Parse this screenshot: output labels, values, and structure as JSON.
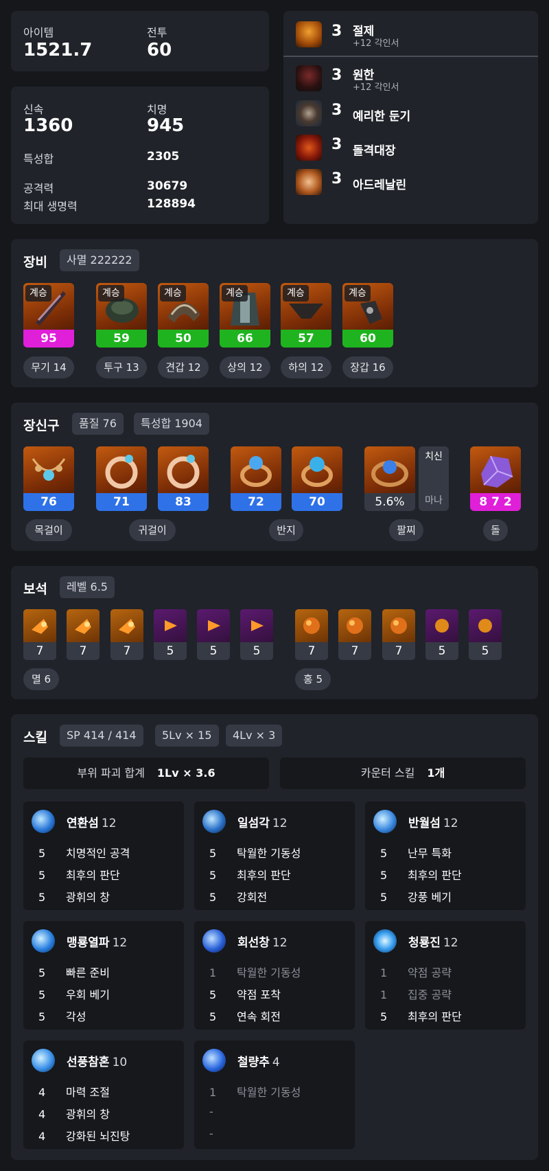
{
  "stats_top": {
    "item_label": "아이템",
    "item_value": "1521.7",
    "combat_label": "전투",
    "combat_value": "60"
  },
  "stats_main": {
    "swift_label": "신속",
    "swift_value": "1360",
    "crit_label": "치명",
    "crit_value": "945",
    "stat_sum_label": "특성합",
    "stat_sum_value": "2305",
    "attack_label": "공격력",
    "attack_value": "30679",
    "hp_label": "최대 생명력",
    "hp_value": "128894"
  },
  "engravings": [
    {
      "level": "3",
      "name": "절제",
      "sub": "+12 각인서",
      "icon": "engraving-icon"
    },
    {
      "level": "3",
      "name": "원한",
      "sub": "+12 각인서",
      "icon": "engraving-icon"
    },
    {
      "level": "3",
      "name": "예리한 둔기",
      "sub": "",
      "icon": "engraving-icon"
    },
    {
      "level": "3",
      "name": "돌격대장",
      "sub": "",
      "icon": "engraving-icon"
    },
    {
      "level": "3",
      "name": "아드레날린",
      "sub": "",
      "icon": "engraving-icon"
    }
  ],
  "equipment": {
    "title": "장비",
    "set_tag": "사멸 222222",
    "items": [
      {
        "badge": "계승",
        "quality": "95",
        "label": "무기 14",
        "icon": "weapon-icon",
        "bar_color": "#e01fd9"
      },
      {
        "badge": "계승",
        "quality": "59",
        "label": "투구 13",
        "icon": "helmet-icon",
        "bar_color": "#1fb41f"
      },
      {
        "badge": "계승",
        "quality": "50",
        "label": "견갑 12",
        "icon": "shoulder-icon",
        "bar_color": "#1fb41f"
      },
      {
        "badge": "계승",
        "quality": "66",
        "label": "상의 12",
        "icon": "chest-icon",
        "bar_color": "#1fb41f"
      },
      {
        "badge": "계승",
        "quality": "57",
        "label": "하의 12",
        "icon": "pants-icon",
        "bar_color": "#1fb41f"
      },
      {
        "badge": "계승",
        "quality": "60",
        "label": "장갑 16",
        "icon": "gloves-icon",
        "bar_color": "#1fb41f"
      }
    ]
  },
  "accessories": {
    "title": "장신구",
    "quality_tag": "품질 76",
    "stat_tag": "특성합 1904",
    "items": [
      {
        "value": "76",
        "icon": "necklace-icon",
        "bar_color": "#2f72e8"
      },
      {
        "value": "71",
        "icon": "earring-icon",
        "bar_color": "#2f72e8"
      },
      {
        "value": "83",
        "icon": "earring-icon",
        "bar_color": "#2f72e8"
      },
      {
        "value": "72",
        "icon": "ring-icon",
        "bar_color": "#2f72e8"
      },
      {
        "value": "70",
        "icon": "ring-icon",
        "bar_color": "#2f72e8"
      },
      {
        "value": "5.6%",
        "icon": "bracelet-icon",
        "bar_color": "#363a44"
      },
      {
        "value": "8 7 2",
        "icon": "stone-icon",
        "bar_color": "#e01fd9"
      }
    ],
    "bracelet_stats": [
      "치신",
      "마나"
    ],
    "labels": {
      "necklace": "목걸이",
      "earring": "귀걸이",
      "ring": "반지",
      "bracelet": "팔찌",
      "stone": "돌"
    }
  },
  "gems": {
    "title": "보석",
    "level_tag": "레벨 6.5",
    "left": [
      {
        "value": "7",
        "color": "orange"
      },
      {
        "value": "7",
        "color": "orange"
      },
      {
        "value": "7",
        "color": "orange"
      },
      {
        "value": "5",
        "color": "purple"
      },
      {
        "value": "5",
        "color": "purple"
      },
      {
        "value": "5",
        "color": "purple"
      }
    ],
    "right": [
      {
        "value": "7",
        "color": "orange"
      },
      {
        "value": "7",
        "color": "orange"
      },
      {
        "value": "7",
        "color": "orange"
      },
      {
        "value": "5",
        "color": "purple"
      },
      {
        "value": "5",
        "color": "purple"
      }
    ],
    "left_label": "멸 6",
    "right_label": "홍 5"
  },
  "skills": {
    "title": "스킬",
    "sp_tag": "SP 414 / 414",
    "lv5_tag": "5Lv × 15",
    "lv4_tag": "4Lv × 3",
    "break_label": "부위 파괴 합계",
    "break_value": "1Lv × 3.6",
    "counter_label": "카운터 스킬",
    "counter_value": "1개",
    "list": [
      {
        "name": "연환섬",
        "level": "12",
        "tripods": [
          {
            "lv": "5",
            "name": "치명적인 공격",
            "active": true
          },
          {
            "lv": "5",
            "name": "최후의 판단",
            "active": true
          },
          {
            "lv": "5",
            "name": "광휘의 창",
            "active": true
          }
        ]
      },
      {
        "name": "일섬각",
        "level": "12",
        "tripods": [
          {
            "lv": "5",
            "name": "탁월한 기동성",
            "active": true
          },
          {
            "lv": "5",
            "name": "최후의 판단",
            "active": true
          },
          {
            "lv": "5",
            "name": "강회전",
            "active": true
          }
        ]
      },
      {
        "name": "반월섬",
        "level": "12",
        "tripods": [
          {
            "lv": "5",
            "name": "난무 특화",
            "active": true
          },
          {
            "lv": "5",
            "name": "최후의 판단",
            "active": true
          },
          {
            "lv": "5",
            "name": "강풍 베기",
            "active": true
          }
        ]
      },
      {
        "name": "맹룡열파",
        "level": "12",
        "tripods": [
          {
            "lv": "5",
            "name": "빠른 준비",
            "active": true
          },
          {
            "lv": "5",
            "name": "우회 베기",
            "active": true
          },
          {
            "lv": "5",
            "name": "각성",
            "active": true
          }
        ]
      },
      {
        "name": "회선창",
        "level": "12",
        "tripods": [
          {
            "lv": "1",
            "name": "탁월한 기동성",
            "active": false
          },
          {
            "lv": "5",
            "name": "약점 포착",
            "active": true
          },
          {
            "lv": "5",
            "name": "연속 회전",
            "active": true
          }
        ]
      },
      {
        "name": "청룡진",
        "level": "12",
        "tripods": [
          {
            "lv": "1",
            "name": "약점 공략",
            "active": false
          },
          {
            "lv": "1",
            "name": "집중 공략",
            "active": false
          },
          {
            "lv": "5",
            "name": "최후의 판단",
            "active": true
          }
        ]
      },
      {
        "name": "선풍참혼",
        "level": "10",
        "tripods": [
          {
            "lv": "4",
            "name": "마력 조절",
            "active": true
          },
          {
            "lv": "4",
            "name": "광휘의 창",
            "active": true
          },
          {
            "lv": "4",
            "name": "강화된 뇌진탕",
            "active": true
          }
        ]
      },
      {
        "name": "철량추",
        "level": "4",
        "tripods": [
          {
            "lv": "1",
            "name": "탁월한 기동성",
            "active": false
          },
          {
            "lv": "-",
            "name": "",
            "active": false
          },
          {
            "lv": "-",
            "name": "",
            "active": false
          }
        ]
      }
    ]
  }
}
